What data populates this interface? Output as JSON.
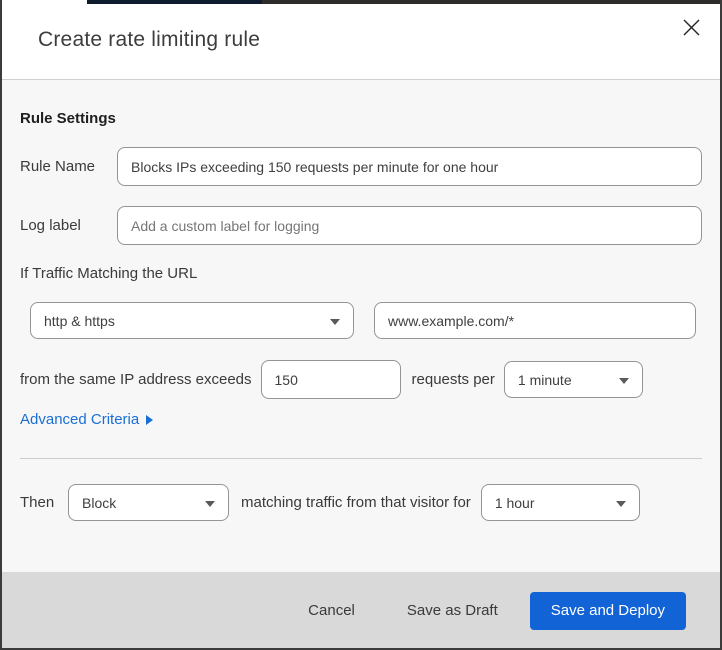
{
  "dialog": {
    "title": "Create rate limiting rule"
  },
  "rule_settings": {
    "heading": "Rule Settings",
    "rule_name": {
      "label": "Rule Name",
      "value": "Blocks IPs exceeding 150 requests per minute for one hour"
    },
    "log_label": {
      "label": "Log label",
      "placeholder": "Add a custom label for logging"
    }
  },
  "traffic_match": {
    "heading": "If Traffic Matching the URL",
    "scheme_select": {
      "value": "http & https"
    },
    "url_input": {
      "value": "www.example.com/*"
    },
    "threshold_prefix": "from the same IP address exceeds",
    "threshold_input": {
      "value": "150"
    },
    "threshold_suffix": "requests per",
    "period_select": {
      "value": "1 minute"
    },
    "advanced_link_label": "Advanced Criteria"
  },
  "action": {
    "then_label": "Then",
    "action_select": {
      "value": "Block"
    },
    "middle_text": "matching traffic from that visitor for",
    "duration_select": {
      "value": "1 hour"
    }
  },
  "footer": {
    "cancel_label": "Cancel",
    "save_draft_label": "Save as Draft",
    "save_deploy_label": "Save and Deploy"
  },
  "colors": {
    "primary_button_blue": "#1263d5",
    "link_blue": "#1a6fd4",
    "body_background": "#f7f7f7",
    "footer_background": "#d9d9d9"
  }
}
